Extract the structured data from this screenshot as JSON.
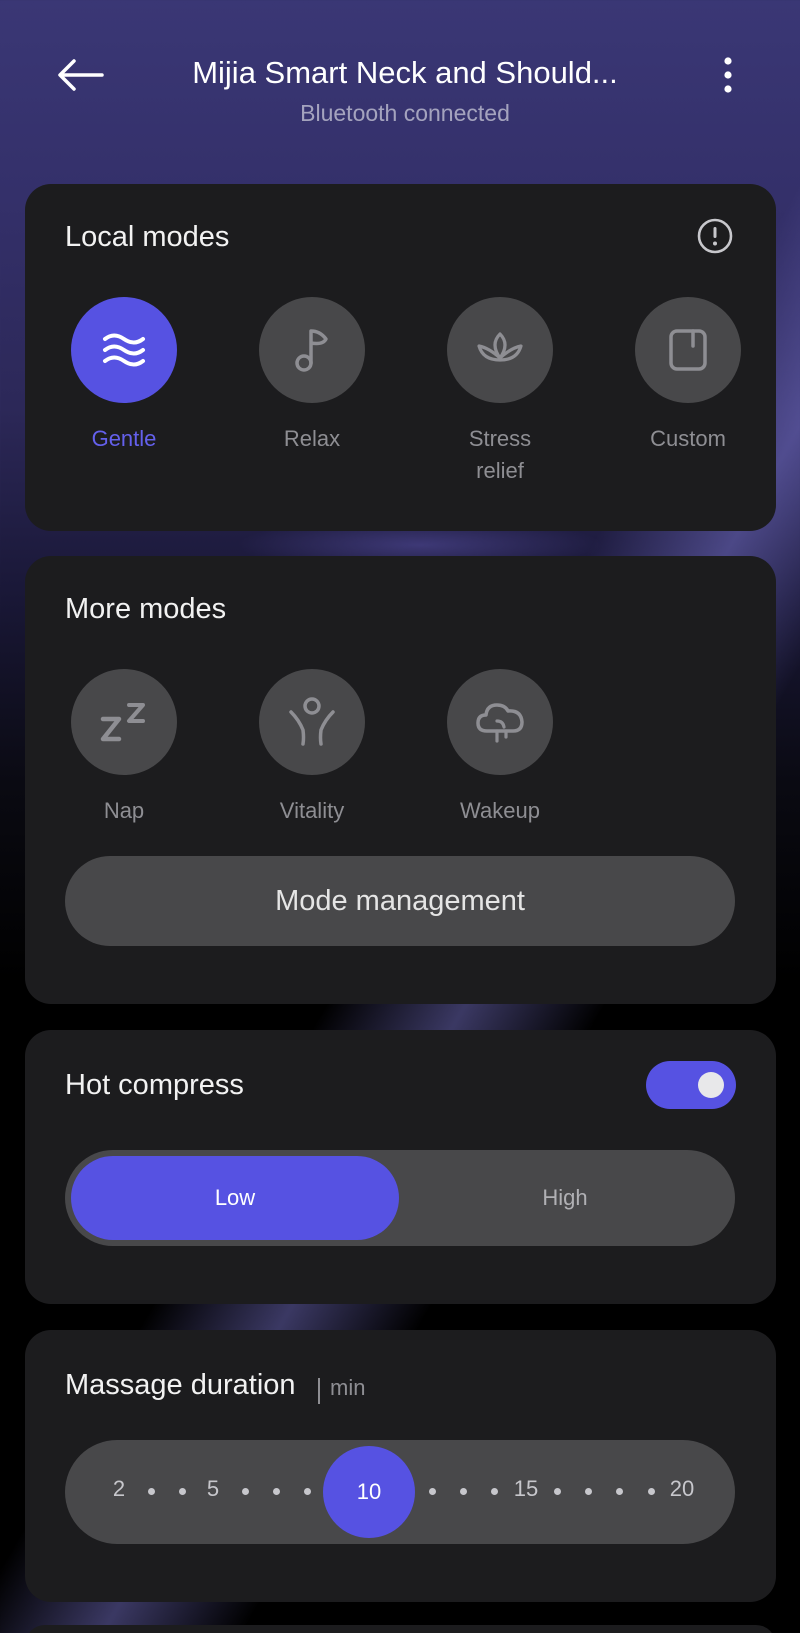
{
  "header": {
    "title": "Mijia Smart Neck and Should...",
    "subtitle": "Bluetooth connected"
  },
  "local_modes": {
    "title": "Local modes",
    "info_icon": "info-circle-icon",
    "items": [
      {
        "label": "Gentle",
        "icon": "waves-icon",
        "active": true
      },
      {
        "label": "Relax",
        "icon": "music-note-icon",
        "active": false
      },
      {
        "label": "Stress\nrelief",
        "icon": "lotus-icon",
        "active": false
      },
      {
        "label": "Custom",
        "icon": "custom-icon",
        "active": false
      }
    ]
  },
  "more_modes": {
    "title": "More modes",
    "items": [
      {
        "label": "Nap",
        "icon": "zz-icon"
      },
      {
        "label": "Vitality",
        "icon": "person-stretch-icon"
      },
      {
        "label": "Wakeup",
        "icon": "cloud-brain-icon"
      }
    ],
    "button_label": "Mode management"
  },
  "hot_compress": {
    "title": "Hot compress",
    "enabled": true,
    "options": [
      "Low",
      "High"
    ],
    "selected": "Low"
  },
  "massage_duration": {
    "title": "Massage duration",
    "unit": "min",
    "ticks": [
      "2",
      "5",
      "10",
      "15",
      "20"
    ],
    "value": "10"
  },
  "colors": {
    "accent": "#5652e2",
    "card": "#1c1c1e",
    "control": "#48484a"
  }
}
